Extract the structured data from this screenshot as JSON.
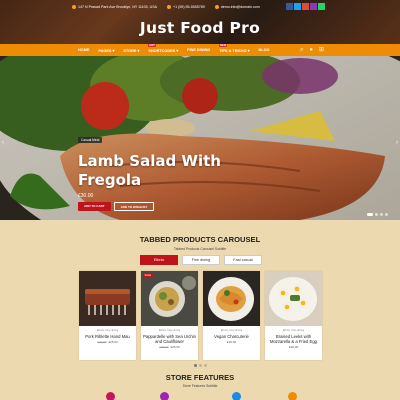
{
  "topbar": {
    "address": "147 N Prasad Park Ave Brooklyn, NY 11105, USA",
    "phone": "+1 (55) 55-5555789",
    "email": "demo.info@domain.com"
  },
  "social_icons": [
    "facebook-icon",
    "twitter-icon",
    "google-plus-icon",
    "instagram-icon",
    "whatsapp-icon"
  ],
  "brand": {
    "title": "Just Food Pro"
  },
  "nav": {
    "items": [
      {
        "label": "Home",
        "badge": ""
      },
      {
        "label": "Pages",
        "badge": ""
      },
      {
        "label": "Store",
        "badge": ""
      },
      {
        "label": "Shortcodes",
        "badge": "HOT"
      },
      {
        "label": "Fine Dining",
        "badge": ""
      },
      {
        "label": "Tips & Tricks",
        "badge": "NEW"
      },
      {
        "label": "Blog",
        "badge": ""
      }
    ]
  },
  "hero": {
    "tag": "Casual Meal",
    "title_line1": "Lamb Salad With",
    "title_line2": "Fregola",
    "price": "£30.00",
    "add_to_cart": "ADD TO CART",
    "add_to_wishlist": "ADD TO WISHLIST"
  },
  "section": {
    "title": "TABBED PRODUCTS CAROUSEL",
    "subtitle": "Tabbed Products Carousel Subtitle",
    "tabs": [
      "Ethnic",
      "Fine dining",
      "Fast casual"
    ]
  },
  "products": [
    {
      "category": "Ethnic, Fine dining",
      "name": "Pork Riblette Hand Mau",
      "old_price": "£30.00",
      "price": "£25.00",
      "sale": ""
    },
    {
      "category": "Ethnic, Fine dining",
      "name": "Pappardelle with Sea Urchin and Cauliflower",
      "old_price": "£30.00",
      "price": "£25.00",
      "sale": "SALE"
    },
    {
      "category": "Ethnic, Fine dining",
      "name": "Vegan Charcuterie",
      "old_price": "",
      "price": "£25.00",
      "sale": ""
    },
    {
      "category": "Ethnic, Fine dining",
      "name": "Braised Leeks with Mozzarella & a Fried Egg",
      "old_price": "",
      "price": "£30.00",
      "sale": ""
    }
  ],
  "features": {
    "title": "STORE FEATURES",
    "subtitle": "Store Features Subtitle"
  },
  "colors": {
    "accent": "#ef8c06",
    "primary_red": "#c0141b",
    "background": "#ecd9b0"
  }
}
